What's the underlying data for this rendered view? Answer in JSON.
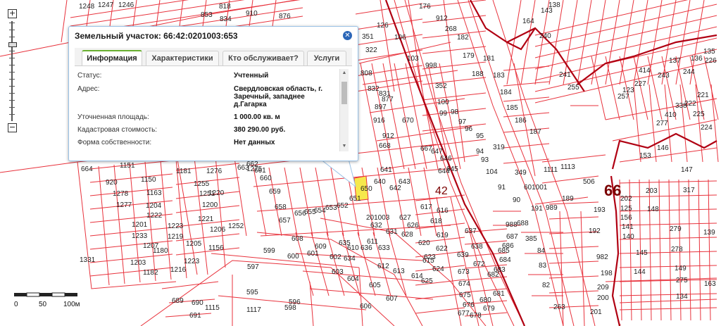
{
  "popup": {
    "title": "Земельный участок: 66:42:0201003:653",
    "tabs": [
      {
        "label": "Информация",
        "active": true
      },
      {
        "label": "Характеристики",
        "active": false
      },
      {
        "label": "Кто обслуживает?",
        "active": false
      },
      {
        "label": "Услуги",
        "active": false
      }
    ],
    "properties": [
      {
        "key": "Статус:",
        "value": "Учтенный"
      },
      {
        "key": "Адрес:",
        "value": "Свердловская область, г. Заречный, западнее д.Гагарка"
      },
      {
        "key": "Уточненная площадь:",
        "value": "1 000.00 кв. м"
      },
      {
        "key": "Кадастровая стоимость:",
        "value": "380 290.00 руб."
      },
      {
        "key": "Форма собственности:",
        "value": "Нет данных"
      }
    ]
  },
  "zoom": {
    "plus": "+",
    "minus": "−"
  },
  "scale": {
    "label_0": "0",
    "label_50": "50",
    "label_100": "100м"
  },
  "map": {
    "zone_labels": [
      "42",
      "66"
    ],
    "block_labels": [
      "601001",
      "201003"
    ],
    "selected_parcel": "653",
    "colors": {
      "boundary": "#e8323c",
      "zone_boundary": "#b00012",
      "highlight": "#f6e84c"
    },
    "parcel_labels": [
      {
        "t": "1248"
      },
      {
        "t": "1247"
      },
      {
        "t": "1246"
      },
      {
        "t": "910"
      },
      {
        "t": "876"
      },
      {
        "t": "818"
      },
      {
        "t": "834"
      },
      {
        "t": "853"
      },
      {
        "t": "813"
      },
      {
        "t": "126"
      },
      {
        "t": "106"
      },
      {
        "t": "176"
      },
      {
        "t": "912"
      },
      {
        "t": "268"
      },
      {
        "t": "182"
      },
      {
        "t": "179"
      },
      {
        "t": "188"
      },
      {
        "t": "181"
      },
      {
        "t": "183"
      },
      {
        "t": "184"
      },
      {
        "t": "185"
      },
      {
        "t": "186"
      },
      {
        "t": "187"
      },
      {
        "t": "351"
      },
      {
        "t": "322"
      },
      {
        "t": "103"
      },
      {
        "t": "998"
      },
      {
        "t": "352"
      },
      {
        "t": "100"
      },
      {
        "t": "99"
      },
      {
        "t": "98"
      },
      {
        "t": "97"
      },
      {
        "t": "96"
      },
      {
        "t": "95"
      },
      {
        "t": "94"
      },
      {
        "t": "319"
      },
      {
        "t": "93"
      },
      {
        "t": "104"
      },
      {
        "t": "349"
      },
      {
        "t": "91"
      },
      {
        "t": "90"
      },
      {
        "t": "989"
      },
      {
        "t": "988"
      },
      {
        "t": "385"
      },
      {
        "t": "84"
      },
      {
        "t": "83"
      },
      {
        "t": "82"
      },
      {
        "t": "263"
      },
      {
        "t": "808"
      },
      {
        "t": "832"
      },
      {
        "t": "831"
      },
      {
        "t": "877"
      },
      {
        "t": "897"
      },
      {
        "t": "916"
      },
      {
        "t": "670"
      },
      {
        "t": "912"
      },
      {
        "t": "668"
      },
      {
        "t": "667"
      },
      {
        "t": "647"
      },
      {
        "t": "646"
      },
      {
        "t": "645"
      },
      {
        "t": "644"
      },
      {
        "t": "643"
      },
      {
        "t": "642"
      },
      {
        "t": "641"
      },
      {
        "t": "640"
      },
      {
        "t": "650"
      },
      {
        "t": "651"
      },
      {
        "t": "652"
      },
      {
        "t": "653"
      },
      {
        "t": "654"
      },
      {
        "t": "655"
      },
      {
        "t": "656"
      },
      {
        "t": "657"
      },
      {
        "t": "658"
      },
      {
        "t": "659"
      },
      {
        "t": "660"
      },
      {
        "t": "661"
      },
      {
        "t": "662"
      },
      {
        "t": "663"
      },
      {
        "t": "664"
      },
      {
        "t": "1151"
      },
      {
        "t": "1181"
      },
      {
        "t": "1276"
      },
      {
        "t": "1275"
      },
      {
        "t": "920"
      },
      {
        "t": "1150"
      },
      {
        "t": "1255"
      },
      {
        "t": "1278"
      },
      {
        "t": "1163"
      },
      {
        "t": "1251"
      },
      {
        "t": "1220"
      },
      {
        "t": "1277"
      },
      {
        "t": "1204"
      },
      {
        "t": "1200"
      },
      {
        "t": "1222"
      },
      {
        "t": "1221"
      },
      {
        "t": "1201"
      },
      {
        "t": "1223"
      },
      {
        "t": "1206"
      },
      {
        "t": "1252"
      },
      {
        "t": "1233"
      },
      {
        "t": "1219"
      },
      {
        "t": "1207"
      },
      {
        "t": "1205"
      },
      {
        "t": "1180"
      },
      {
        "t": "1156"
      },
      {
        "t": "1203"
      },
      {
        "t": "1223"
      },
      {
        "t": "1182"
      },
      {
        "t": "1216"
      },
      {
        "t": "1331"
      },
      {
        "t": "599"
      },
      {
        "t": "600"
      },
      {
        "t": "601"
      },
      {
        "t": "602"
      },
      {
        "t": "597"
      },
      {
        "t": "603"
      },
      {
        "t": "604"
      },
      {
        "t": "605"
      },
      {
        "t": "595"
      },
      {
        "t": "596"
      },
      {
        "t": "598"
      },
      {
        "t": "606"
      },
      {
        "t": "607"
      },
      {
        "t": "608"
      },
      {
        "t": "609"
      },
      {
        "t": "610"
      },
      {
        "t": "611"
      },
      {
        "t": "612"
      },
      {
        "t": "613"
      },
      {
        "t": "614"
      },
      {
        "t": "615"
      },
      {
        "t": "616"
      },
      {
        "t": "617"
      },
      {
        "t": "618"
      },
      {
        "t": "619"
      },
      {
        "t": "620"
      },
      {
        "t": "622"
      },
      {
        "t": "623"
      },
      {
        "t": "624"
      },
      {
        "t": "625"
      },
      {
        "t": "626"
      },
      {
        "t": "627"
      },
      {
        "t": "628"
      },
      {
        "t": "631"
      },
      {
        "t": "632"
      },
      {
        "t": "633"
      },
      {
        "t": "634"
      },
      {
        "t": "635"
      },
      {
        "t": "636"
      },
      {
        "t": "637"
      },
      {
        "t": "638"
      },
      {
        "t": "639"
      },
      {
        "t": "672"
      },
      {
        "t": "673"
      },
      {
        "t": "674"
      },
      {
        "t": "675"
      },
      {
        "t": "676"
      },
      {
        "t": "677"
      },
      {
        "t": "678"
      },
      {
        "t": "679"
      },
      {
        "t": "680"
      },
      {
        "t": "681"
      },
      {
        "t": "682"
      },
      {
        "t": "683"
      },
      {
        "t": "684"
      },
      {
        "t": "685"
      },
      {
        "t": "686"
      },
      {
        "t": "687"
      },
      {
        "t": "688"
      },
      {
        "t": "689"
      },
      {
        "t": "690"
      },
      {
        "t": "691"
      },
      {
        "t": "1115"
      },
      {
        "t": "1117"
      },
      {
        "t": "1111"
      },
      {
        "t": "1113"
      },
      {
        "t": "506"
      },
      {
        "t": "189"
      },
      {
        "t": "191"
      },
      {
        "t": "193"
      },
      {
        "t": "192"
      },
      {
        "t": "982"
      },
      {
        "t": "198"
      },
      {
        "t": "209"
      },
      {
        "t": "200"
      },
      {
        "t": "201"
      },
      {
        "t": "202"
      },
      {
        "t": "203"
      },
      {
        "t": "317"
      },
      {
        "t": "125"
      },
      {
        "t": "148"
      },
      {
        "t": "156"
      },
      {
        "t": "141"
      },
      {
        "t": "279"
      },
      {
        "t": "140"
      },
      {
        "t": "145"
      },
      {
        "t": "278"
      },
      {
        "t": "139"
      },
      {
        "t": "144"
      },
      {
        "t": "149"
      },
      {
        "t": "275"
      },
      {
        "t": "134"
      },
      {
        "t": "163"
      },
      {
        "t": "147"
      },
      {
        "t": "153"
      },
      {
        "t": "146"
      },
      {
        "t": "277"
      },
      {
        "t": "410"
      },
      {
        "t": "338"
      },
      {
        "t": "222"
      },
      {
        "t": "221"
      },
      {
        "t": "224"
      },
      {
        "t": "225"
      },
      {
        "t": "226"
      },
      {
        "t": "414"
      },
      {
        "t": "227"
      },
      {
        "t": "123"
      },
      {
        "t": "257"
      },
      {
        "t": "255"
      },
      {
        "t": "241"
      },
      {
        "t": "240"
      },
      {
        "t": "164"
      },
      {
        "t": "143"
      },
      {
        "t": "138"
      },
      {
        "t": "137"
      },
      {
        "t": "136"
      },
      {
        "t": "135"
      },
      {
        "t": "244"
      },
      {
        "t": "243"
      },
      {
        "t": "242"
      },
      {
        "t": "261"
      },
      {
        "t": "262"
      }
    ]
  }
}
